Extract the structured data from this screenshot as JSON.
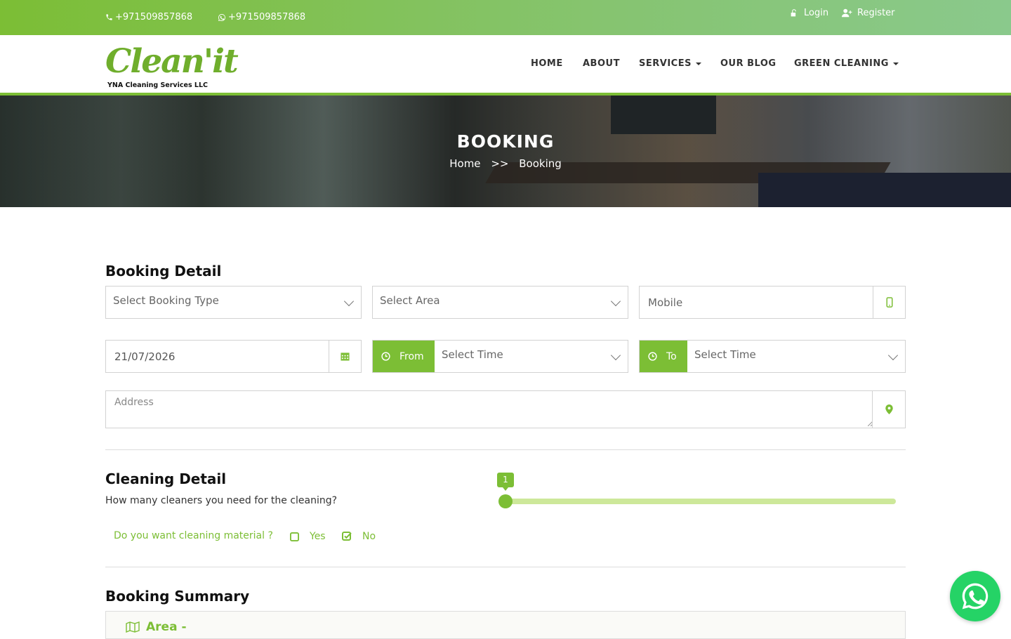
{
  "topbar": {
    "phone": "+971509857868",
    "whatsapp": "+971509857868",
    "login": "Login",
    "register": "Register"
  },
  "brand": {
    "logo_word": "Clean'it",
    "logo_sub": "YNA Cleaning Services LLC"
  },
  "nav": {
    "home": "HOME",
    "about": "ABOUT",
    "services": "SERVICES",
    "blog": "OUR BLOG",
    "green": "GREEN CLEANING"
  },
  "hero": {
    "title": "BOOKING",
    "crumb_home": "Home",
    "crumb_sep": ">>",
    "crumb_current": "Booking"
  },
  "booking_detail": {
    "heading": "Booking Detail",
    "booking_type_placeholder": "Select Booking Type",
    "area_placeholder": "Select Area",
    "mobile_placeholder": "Mobile",
    "date_value": "21/07/2026",
    "from_label": "From",
    "from_placeholder": "Select Time",
    "to_label": "To",
    "to_placeholder": "Select Time",
    "address_placeholder": "Address"
  },
  "cleaning_detail": {
    "heading": "Cleaning Detail",
    "cleaners_question": "How many cleaners you need for the cleaning?",
    "cleaners_value": "1",
    "slider_fraction": 0,
    "material_question": "Do you want cleaning material ?",
    "material_yes": "Yes",
    "material_no": "No",
    "material_selected": "No"
  },
  "summary": {
    "heading": "Booking Summary",
    "area_label": "Area -"
  },
  "colors": {
    "accent": "#7cbe35",
    "whatsapp": "#25d366"
  }
}
